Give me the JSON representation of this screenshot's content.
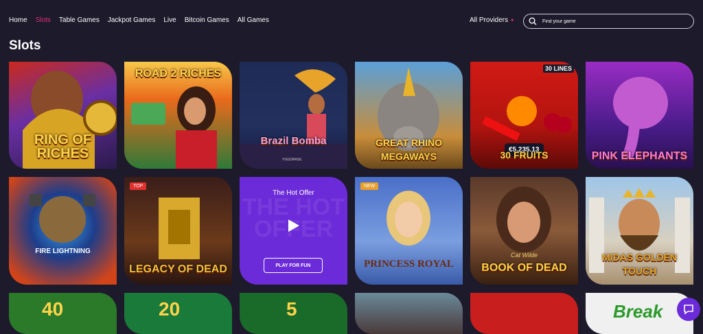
{
  "nav": {
    "links": [
      {
        "label": "Home",
        "active": false
      },
      {
        "label": "Slots",
        "active": true
      },
      {
        "label": "Table Games",
        "active": false
      },
      {
        "label": "Jackpot Games",
        "active": false
      },
      {
        "label": "Live",
        "active": false
      },
      {
        "label": "Bitcoin Games",
        "active": false
      },
      {
        "label": "All Games",
        "active": false
      }
    ],
    "providers_label": "All Providers",
    "search_placeholder": "Find your game"
  },
  "section_title": "Slots",
  "games": [
    {
      "name": "RING OF RICHES",
      "icon": "boxer-icon"
    },
    {
      "name": "ROAD 2 RICHES",
      "icon": "woman-with-cash-icon"
    },
    {
      "name": "Brazil Bomba",
      "icon": "carnival-dancer-icon",
      "provider": "YGGDRASIL"
    },
    {
      "name": "GREAT RHINO MEGAWAYS",
      "icon": "rhino-icon"
    },
    {
      "name": "30 FRUITS",
      "icon": "fruits-icon",
      "top_text": "30 LINES",
      "jackpot": "€5,235.13"
    },
    {
      "name": "PINK ELEPHANTS",
      "icon": "elephant-icon"
    },
    {
      "name": "FIRE LIGHTNING",
      "icon": "warrior-mask-icon"
    },
    {
      "name": "LEGACY OF DEAD",
      "icon": "sarcophagus-icon",
      "badge": "TOP"
    },
    {
      "name": "PRINCESS ROYAL",
      "icon": "princess-icon",
      "badge": "NEW"
    },
    {
      "name": "BOOK OF DEAD",
      "icon": "cat-wilde-icon",
      "sub": "Cat Wilde"
    },
    {
      "name": "MIDAS GOLDEN TOUCH",
      "icon": "king-midas-icon"
    }
  ],
  "hot_offer": {
    "title": "The Hot Offer",
    "bg_text": "THE HOT OFFER",
    "button": "PLAY FOR FUN"
  },
  "bottom_row": [
    "40",
    "20",
    "5",
    "",
    "",
    "Break"
  ],
  "colors": {
    "background": "#1d1a2b",
    "accent": "#e0317b",
    "offer": "#6c2bd9"
  }
}
